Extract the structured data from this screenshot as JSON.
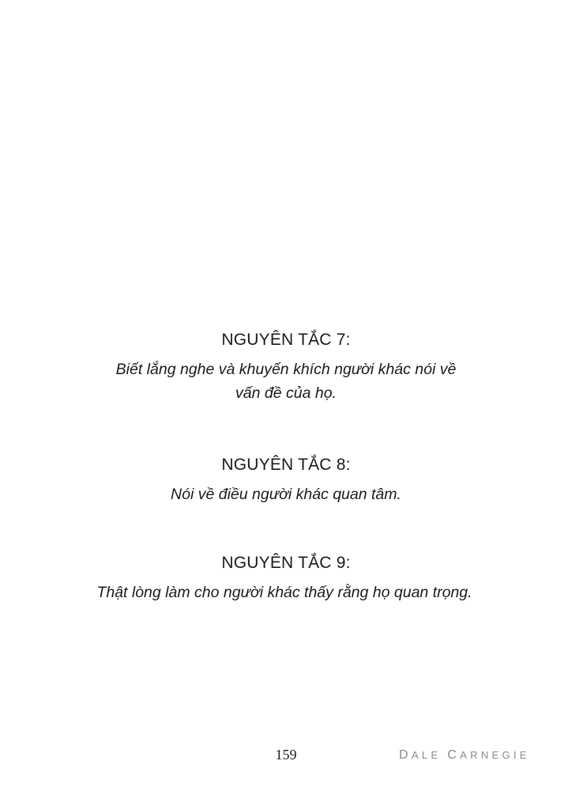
{
  "principles": [
    {
      "heading": "NGUYÊN TẮC 7:",
      "text": "Biết lắng nghe và khuyến khích người khác nói về vấn đề của họ."
    },
    {
      "heading": "NGUYÊN TẮC 8:",
      "text": "Nói về điều người khác quan tâm."
    },
    {
      "heading": "NGUYÊN TẮC 9:",
      "text": "Thật lòng làm cho người khác thấy rằng họ quan trọng."
    }
  ],
  "footer": {
    "page_number": "159",
    "author": "Dale Carnegie"
  }
}
